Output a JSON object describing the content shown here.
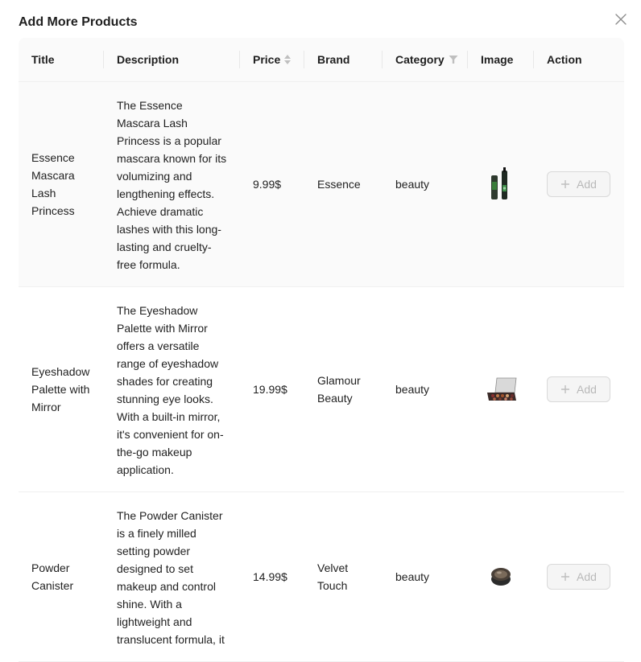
{
  "modal": {
    "title": "Add More Products",
    "close_label": "×"
  },
  "table": {
    "columns": {
      "title": "Title",
      "description": "Description",
      "price": "Price",
      "brand": "Brand",
      "category": "Category",
      "image": "Image",
      "action": "Action"
    },
    "rows": [
      {
        "title": "Essence Mascara Lash Princess",
        "description": "The Essence Mascara Lash Princess is a popular mascara known for its volumizing and lengthening effects. Achieve dramatic lashes with this long-lasting and cruelty-free formula.",
        "price": "9.99$",
        "brand": "Essence",
        "category": "beauty",
        "image_icon": "mascara-product-image",
        "action_label": "Add"
      },
      {
        "title": "Eyeshadow Palette with Mirror",
        "description": "The Eyeshadow Palette with Mirror offers a versatile range of eyeshadow shades for creating stunning eye looks. With a built-in mirror, it's convenient for on-the-go makeup application.",
        "price": "19.99$",
        "brand": "Glamour Beauty",
        "category": "beauty",
        "image_icon": "eyeshadow-palette-product-image",
        "action_label": "Add"
      },
      {
        "title": "Powder Canister",
        "description": "The Powder Canister is a finely milled setting powder designed to set makeup and control shine. With a lightweight and translucent formula, it",
        "price": "14.99$",
        "brand": "Velvet Touch",
        "category": "beauty",
        "image_icon": "powder-canister-product-image",
        "action_label": "Add"
      }
    ]
  },
  "colors": {
    "header_bg": "#fafafa",
    "border": "#f0f0f0",
    "disabled_text": "#bfbfbf"
  }
}
